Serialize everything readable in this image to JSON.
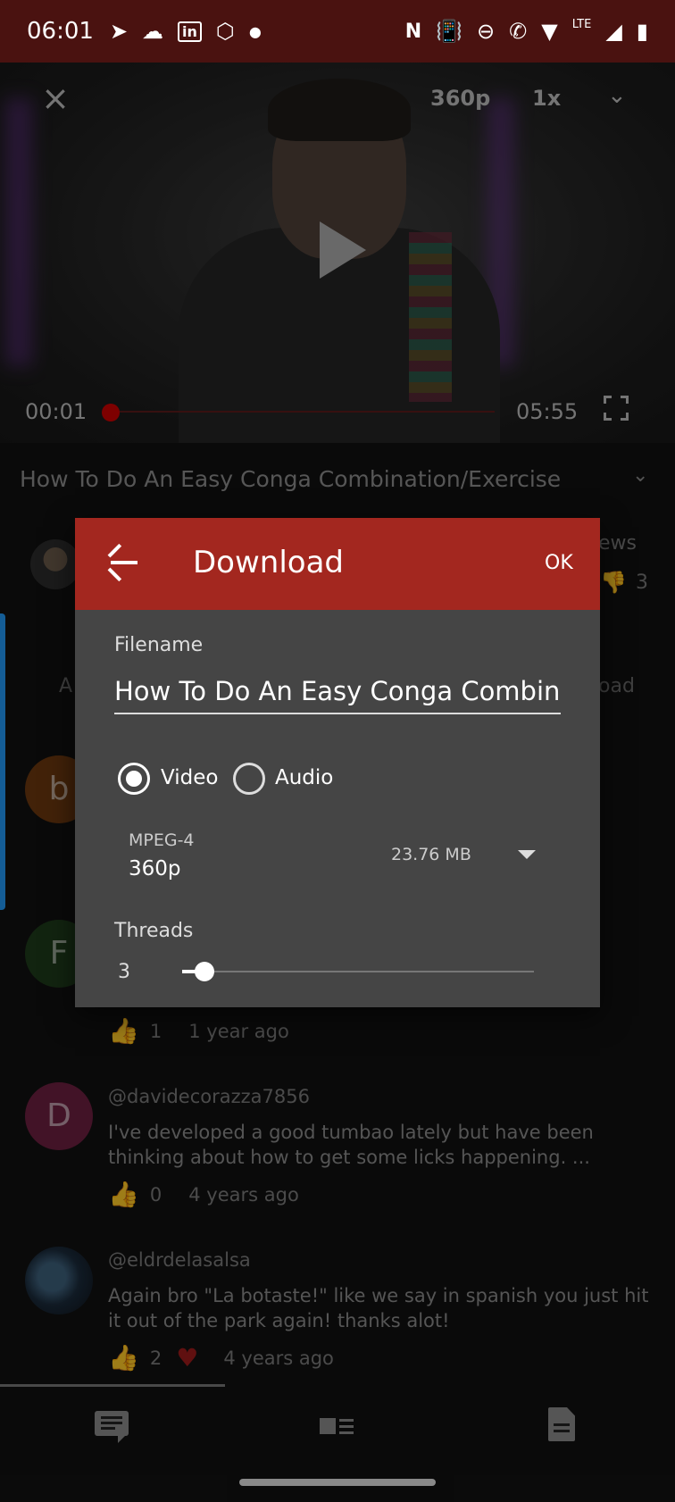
{
  "status_bar": {
    "time": "06:01",
    "network": "LTE"
  },
  "player": {
    "quality": "360p",
    "speed": "1x",
    "current_time": "00:01",
    "total_time": "05:55",
    "progress": 0.003
  },
  "video": {
    "title": "How To Do An Easy Conga Combination/Exercise",
    "views_fragment": "ews",
    "dislike_count": "3",
    "left_fragment": "A",
    "right_fragment": "oad"
  },
  "comments": [
    {
      "avatar_letter": "b",
      "author": "",
      "text": "",
      "likes": "",
      "age": ""
    },
    {
      "avatar_letter": "F",
      "author": "",
      "text": "",
      "likes": "1",
      "age": "1 year ago"
    },
    {
      "avatar_letter": "D",
      "author": "@davidecorazza7856",
      "text": "I've developed a good tumbao lately but have been thinking about how to get some licks happening. ...",
      "likes": "0",
      "age": "4 years ago"
    },
    {
      "avatar_letter": "",
      "author": "@eldrdelasalsa",
      "text": "Again bro \"La botaste!\" like we say in spanish you just hit it out of the park again! thanks alot!",
      "likes": "2",
      "age": "4 years ago",
      "hearted": true
    }
  ],
  "dialog": {
    "title": "Download",
    "ok_label": "OK",
    "filename_label": "Filename",
    "filename_value": "How To Do An Easy Conga Combination/Exercise",
    "video_label": "Video",
    "audio_label": "Audio",
    "selected_type": "video",
    "format_type": "MPEG-4",
    "format_resolution": "360p",
    "format_size": "23.76 MB",
    "threads_label": "Threads",
    "threads_value": "3",
    "threads_min": 1,
    "threads_max": 32
  },
  "colors": {
    "accent": "#a3271f",
    "status_bar": "#4a1210",
    "dialog_bg": "#454545",
    "heart": "#9b1a1a",
    "progress": "#cc0000"
  }
}
